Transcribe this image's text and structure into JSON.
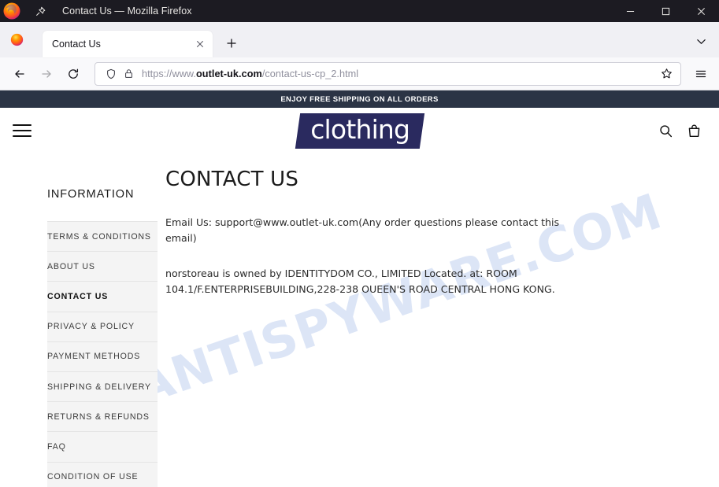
{
  "window": {
    "title": "Contact Us — Mozilla Firefox",
    "pin_icon": "pin-icon",
    "firefox_logo": "firefox-logo-icon",
    "controls": {
      "minimize": "minimize-icon",
      "maximize": "maximize-icon",
      "close": "close-icon"
    }
  },
  "tabbar": {
    "tabs": [
      {
        "label": "Contact Us",
        "close_icon": "close-icon",
        "active": true
      }
    ],
    "new_tab_icon": "plus-icon",
    "tab_list_icon": "chevron-down-icon"
  },
  "navbar": {
    "back_icon": "back-arrow-icon",
    "forward_icon": "forward-arrow-icon",
    "reload_icon": "reload-icon",
    "shield_icon": "shield-icon",
    "lock_icon": "lock-icon",
    "url_prefix": "https://www.",
    "url_domain": "outlet-uk.com",
    "url_path": "/contact-us-cp_2.html",
    "url_full": "https://www.outlet-uk.com/contact-us-cp_2.html",
    "star_icon": "bookmark-star-icon",
    "app_menu_icon": "hamburger-menu-icon"
  },
  "page": {
    "promo_banner": "ENJOY FREE SHIPPING ON ALL ORDERS",
    "logo_text": "clothing",
    "menu_icon": "hamburger-menu-icon",
    "search_icon": "search-icon",
    "cart_icon": "shopping-bag-icon",
    "watermark": "MYANTISPYWARE.COM",
    "sidebar": {
      "heading": "INFORMATION",
      "items": [
        {
          "label": "TERMS & CONDITIONS",
          "active": false
        },
        {
          "label": "ABOUT US",
          "active": false
        },
        {
          "label": "CONTACT US",
          "active": true
        },
        {
          "label": "PRIVACY & POLICY",
          "active": false
        },
        {
          "label": "PAYMENT METHODS",
          "active": false
        },
        {
          "label": "SHIPPING & DELIVERY",
          "active": false
        },
        {
          "label": "RETURNS & REFUNDS",
          "active": false
        },
        {
          "label": "FAQ",
          "active": false
        },
        {
          "label": "CONDITION OF USE",
          "active": false
        }
      ]
    },
    "main": {
      "title": "CONTACT US",
      "email_line": "Email Us: support@www.outlet-uk.com(Any order questions please contact this email)",
      "address_line": "norstoreau is owned by IDENTITYDOM CO., LIMITED Located. at: ROOM 104.1/F.ENTERPRISEBUILDING,228-238 OUEEN'S ROAD CENTRAL HONG KONG."
    }
  },
  "colors": {
    "promo_bg": "#2b3445",
    "logo_bg": "#2a2a5f",
    "watermark": "#c7d6f2",
    "titlebar_bg": "#1c1b22"
  }
}
